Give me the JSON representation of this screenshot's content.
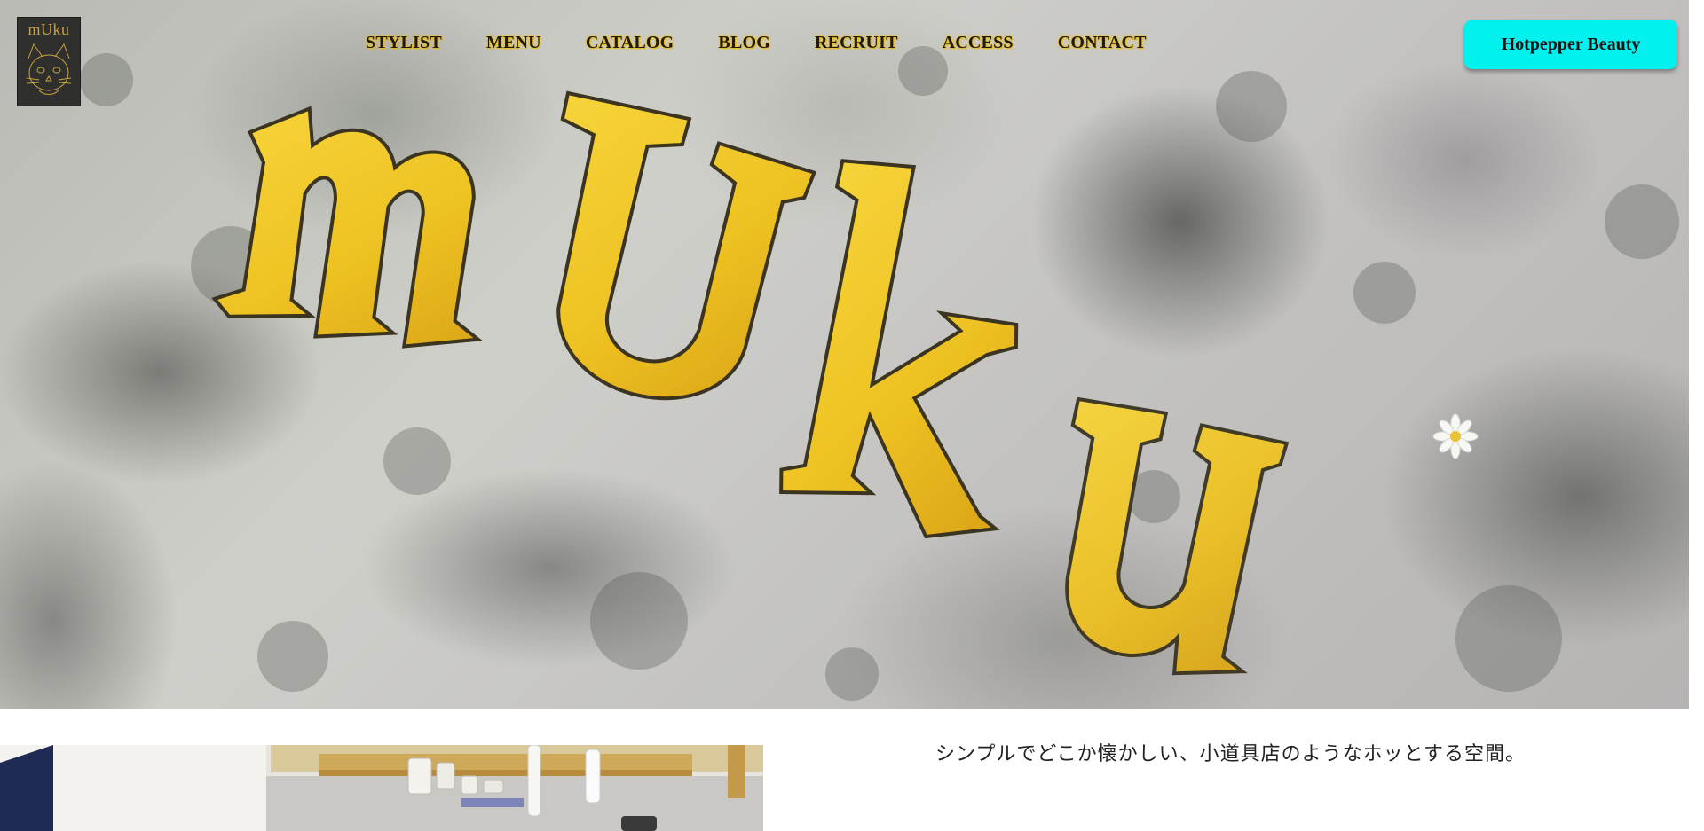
{
  "logo": {
    "text": "mUku",
    "icon": "cat-face-logo-icon"
  },
  "nav": {
    "items": [
      "STYLIST",
      "MENU",
      "CATALOG",
      "BLOG",
      "RECRUIT",
      "ACCESS",
      "CONTACT"
    ]
  },
  "cta": {
    "label": "Hotpepper Beauty",
    "color": "#00f1ee"
  },
  "hero": {
    "letters": [
      "m",
      "U",
      "k",
      "u"
    ],
    "letter_color": "#f0c51f",
    "description_icon": "daisy-flower-icon"
  },
  "intro": {
    "text": "シンプルでどこか懐かしい、小道具店のようなホッとする空間。"
  },
  "colors": {
    "gold": "#f0c51f",
    "nav_glow": "#f2c21e",
    "background": "#ffffff"
  }
}
